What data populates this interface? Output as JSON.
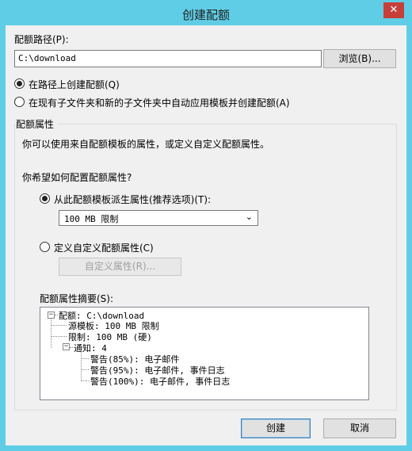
{
  "window": {
    "title": "创建配额",
    "close_glyph": "✕"
  },
  "path": {
    "label": "配额路径(P):",
    "value": "C:\\download",
    "browse_label": "浏览(B)..."
  },
  "mode": {
    "option_create_on_path": "在路径上创建配额(Q)",
    "option_auto_apply": "在现有子文件夹和新的子文件夹中自动应用模板并创建配额(A)",
    "selected": "option_create_on_path"
  },
  "properties": {
    "group_title": "配额属性",
    "description": "你可以使用来自配额模板的属性，或定义自定义配额属性。",
    "question": "你希望如何配置配额属性?",
    "option_template": "从此配额模板派生属性(推荐选项)(T):",
    "template_selected": "100 MB 限制",
    "option_custom": "定义自定义配额属性(C)",
    "custom_button": "自定义属性(R)...",
    "summary_label": "配额属性摘要(S):"
  },
  "summary_tree": {
    "root": "配额: C:\\download",
    "source": "源模板: 100 MB 限制",
    "limit": "限制: 100 MB (硬)",
    "notify": "通知: 4",
    "warnings": [
      "警告(85%): 电子邮件",
      "警告(95%): 电子邮件, 事件日志",
      "警告(100%): 电子邮件, 事件日志"
    ]
  },
  "footer": {
    "create_label": "创建",
    "cancel_label": "取消"
  },
  "colors": {
    "frame": "#60cde6",
    "close": "#c6403a",
    "face": "#f0f0f0"
  }
}
